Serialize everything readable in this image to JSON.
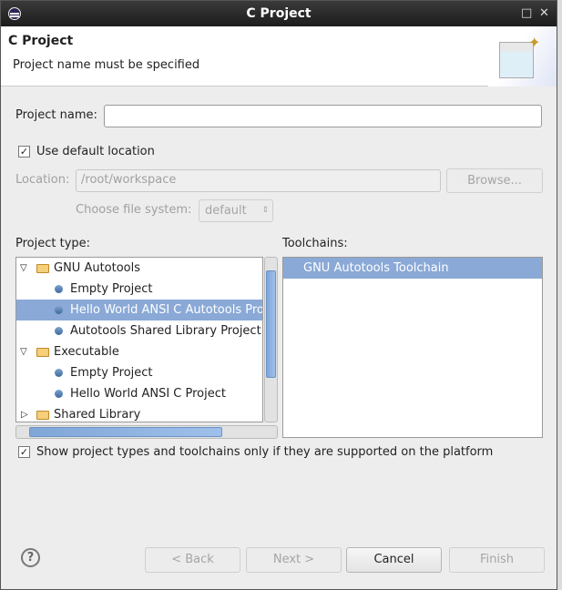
{
  "window": {
    "title": "C Project"
  },
  "banner": {
    "title": "C Project",
    "message": "Project name must be specified"
  },
  "form": {
    "project_name_label": "Project name:",
    "project_name_value": "",
    "use_default_label": "Use default location",
    "use_default_checked": true,
    "location_label": "Location:",
    "location_value": "/root/workspace",
    "browse_label": "Browse...",
    "filesystem_label": "Choose file system:",
    "filesystem_value": "default"
  },
  "project_type": {
    "label": "Project type:",
    "items": [
      {
        "label": "GNU Autotools",
        "kind": "folder",
        "expanded": true
      },
      {
        "label": "Empty Project",
        "kind": "item"
      },
      {
        "label": "Hello World ANSI C Autotools Project",
        "kind": "item",
        "selected": true
      },
      {
        "label": "Autotools Shared Library Project",
        "kind": "item"
      },
      {
        "label": "Executable",
        "kind": "folder",
        "expanded": true
      },
      {
        "label": "Empty Project",
        "kind": "item"
      },
      {
        "label": "Hello World ANSI C Project",
        "kind": "item"
      },
      {
        "label": "Shared Library",
        "kind": "folder",
        "expanded": false
      }
    ]
  },
  "toolchains": {
    "label": "Toolchains:",
    "items": [
      {
        "label": "GNU Autotools Toolchain",
        "selected": true
      }
    ]
  },
  "show_supported": {
    "label": "Show project types and toolchains only if they are supported on the platform",
    "checked": true
  },
  "buttons": {
    "back": "< Back",
    "next": "Next >",
    "cancel": "Cancel",
    "finish": "Finish",
    "help": "?"
  }
}
